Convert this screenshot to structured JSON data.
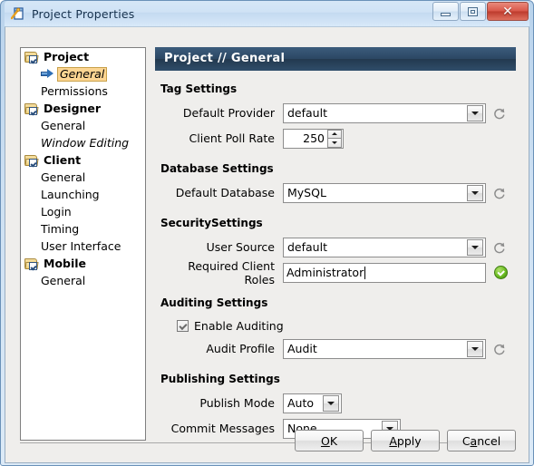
{
  "window": {
    "title": "Project Properties",
    "icon": "project-properties-icon",
    "buttons": {
      "minimize": "minimize-button",
      "maximize": "maximize-button",
      "close": "✕"
    }
  },
  "tree": {
    "items": [
      {
        "label": "Project",
        "type": "group",
        "icon": "folder-check-icon"
      },
      {
        "label": "General",
        "type": "child",
        "icon": "blue-arrow-icon",
        "selected": true,
        "italic": true
      },
      {
        "label": "Permissions",
        "type": "child"
      },
      {
        "label": "Designer",
        "type": "group",
        "icon": "folder-check-icon"
      },
      {
        "label": "General",
        "type": "child"
      },
      {
        "label": "Window Editing",
        "type": "child",
        "italic": true
      },
      {
        "label": "Client",
        "type": "group",
        "icon": "folder-check-icon"
      },
      {
        "label": "General",
        "type": "child"
      },
      {
        "label": "Launching",
        "type": "child"
      },
      {
        "label": "Login",
        "type": "child"
      },
      {
        "label": "Timing",
        "type": "child"
      },
      {
        "label": "User Interface",
        "type": "child"
      },
      {
        "label": "Mobile",
        "type": "group",
        "icon": "folder-check-icon"
      },
      {
        "label": "General",
        "type": "child"
      }
    ]
  },
  "main": {
    "header": "Project // General",
    "groups": {
      "tag": "Tag Settings",
      "database": "Database Settings",
      "security": "SecuritySettings",
      "auditing": "Auditing Settings",
      "publishing": "Publishing Settings"
    },
    "fields": {
      "default_provider": {
        "label": "Default Provider",
        "value": "default"
      },
      "client_poll_rate": {
        "label": "Client Poll Rate",
        "value": "250"
      },
      "default_database": {
        "label": "Default Database",
        "value": "MySQL"
      },
      "user_source": {
        "label": "User Source",
        "value": "default"
      },
      "required_client_roles": {
        "label": "Required Client Roles",
        "value": "Administrator"
      },
      "enable_auditing": {
        "label": "Enable Auditing",
        "value": "checked"
      },
      "audit_profile": {
        "label": "Audit Profile",
        "value": "Audit"
      },
      "publish_mode": {
        "label": "Publish Mode",
        "value": "Auto"
      },
      "commit_messages": {
        "label": "Commit Messages",
        "value": "None"
      }
    }
  },
  "footer": {
    "ok": {
      "pre": "",
      "mn": "O",
      "post": "K"
    },
    "apply": {
      "pre": "",
      "mn": "A",
      "post": "pply"
    },
    "cancel": {
      "pre": "C",
      "mn": "a",
      "post": "ncel"
    }
  },
  "colors": {
    "header_bar": "#2b4763",
    "selection": "#fcd592",
    "ok_badge": "#6cbd22",
    "close_button": "#d9584a"
  }
}
